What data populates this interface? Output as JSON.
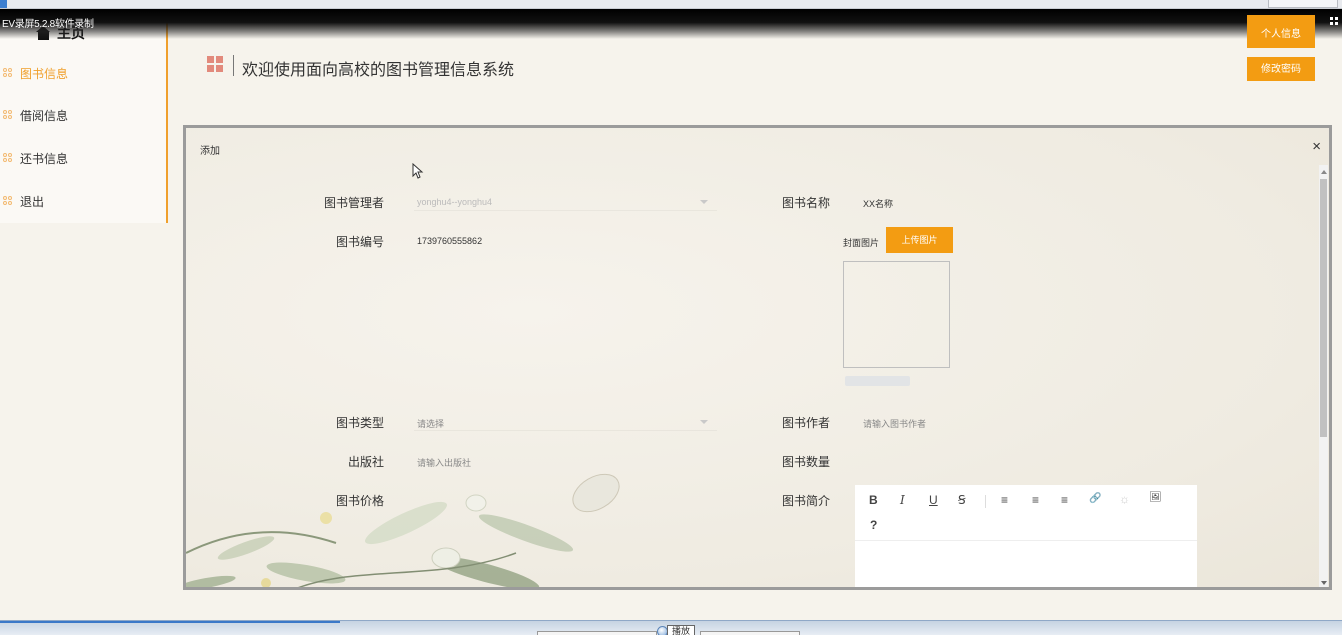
{
  "recorder": {
    "label": "EV录屏5.2.8软件录制",
    "play_tooltip": "播放"
  },
  "sidebar": {
    "home_label": "主页",
    "items": [
      {
        "label": "图书信息",
        "active": true
      },
      {
        "label": "借阅信息",
        "active": false
      },
      {
        "label": "还书信息",
        "active": false
      },
      {
        "label": "退出",
        "active": false
      }
    ]
  },
  "header": {
    "title": "欢迎使用面向高校的图书管理信息系统",
    "profile_button": "个人信息",
    "password_button": "修改密码"
  },
  "modal": {
    "title": "添加",
    "close_label": "×",
    "fields": {
      "manager": {
        "label": "图书管理者",
        "value": "yonghu4--yonghu4"
      },
      "book_name": {
        "label": "图书名称",
        "value": "XX名称"
      },
      "book_no": {
        "label": "图书编号",
        "value": "1739760555862"
      },
      "cover": {
        "label": "封面图片",
        "button": "上传图片"
      },
      "book_type": {
        "label": "图书类型",
        "placeholder": "请选择"
      },
      "author": {
        "label": "图书作者",
        "placeholder": "请输入图书作者"
      },
      "publisher": {
        "label": "出版社",
        "placeholder": "请输入出版社"
      },
      "quantity": {
        "label": "图书数量"
      },
      "price": {
        "label": "图书价格"
      },
      "intro": {
        "label": "图书简介"
      }
    },
    "editor_toolbar": [
      "B",
      "I",
      "U",
      "Ꞩ",
      "≡",
      "≡",
      "≡",
      "🔗",
      "☼",
      "🖼",
      "?"
    ]
  },
  "colors": {
    "accent": "#f39c12",
    "active_nav": "#f0a02c",
    "grid_icon": "#e28a7c"
  }
}
